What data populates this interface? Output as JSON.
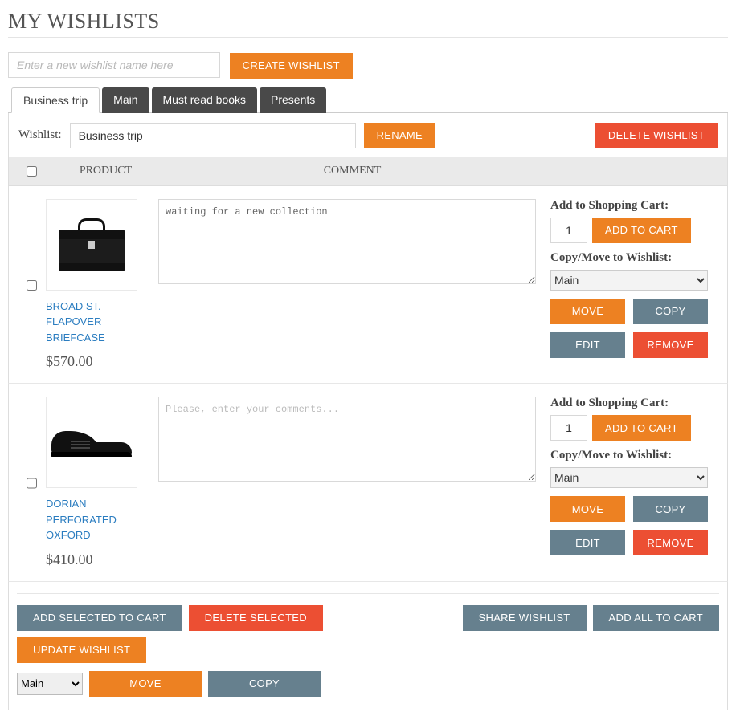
{
  "page": {
    "title": "MY WISHLISTS",
    "new_wishlist_placeholder": "Enter a new wishlist name here",
    "create_button": "CREATE WISHLIST"
  },
  "tabs": [
    {
      "label": "Business trip",
      "active": true
    },
    {
      "label": "Main",
      "active": false
    },
    {
      "label": "Must read books",
      "active": false
    },
    {
      "label": "Presents",
      "active": false
    }
  ],
  "rename": {
    "label": "Wishlist:",
    "value": "Business trip",
    "button": "RENAME",
    "delete_button": "DELETE WISHLIST"
  },
  "columns": {
    "product": "PRODUCT",
    "comment": "COMMENT"
  },
  "action_labels": {
    "add_to_cart_header": "Add to Shopping Cart:",
    "add_to_cart": "ADD TO CART",
    "copy_move_header": "Copy/Move to Wishlist:",
    "move": "MOVE",
    "copy": "COPY",
    "edit": "EDIT",
    "remove": "REMOVE"
  },
  "wishlist_options": [
    "Main"
  ],
  "items": [
    {
      "name": "BROAD ST. FLAPOVER BRIEFCASE",
      "price": "$570.00",
      "comment_value": "waiting for a new collection",
      "comment_placeholder": "Please, enter your comments...",
      "qty": "1",
      "selected_wishlist": "Main",
      "icon": "briefcase"
    },
    {
      "name": "DORIAN PERFORATED OXFORD",
      "price": "$410.00",
      "comment_value": "",
      "comment_placeholder": "Please, enter your comments...",
      "qty": "1",
      "selected_wishlist": "Main",
      "icon": "shoe"
    }
  ],
  "bulk": {
    "add_selected": "ADD SELECTED TO CART",
    "delete_selected": "DELETE SELECTED",
    "share": "SHARE WISHLIST",
    "add_all": "ADD ALL TO CART",
    "update": "UPDATE WISHLIST",
    "selected_wishlist": "Main",
    "move": "MOVE",
    "copy": "COPY"
  }
}
